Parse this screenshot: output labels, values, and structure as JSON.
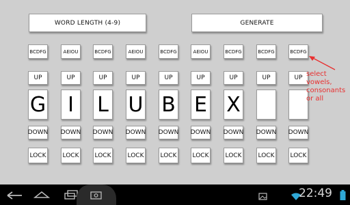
{
  "header": {
    "word_length_label": "WORD LENGTH (4-9)",
    "generate_label": "GENERATE"
  },
  "columns": [
    {
      "type_label": "BCDFG",
      "up_label": "UP",
      "letter": "G",
      "down_label": "DOWN",
      "lock_label": "LOCK"
    },
    {
      "type_label": "AEIOU",
      "up_label": "UP",
      "letter": "I",
      "down_label": "DOWN",
      "lock_label": "LOCK"
    },
    {
      "type_label": "BCDFG",
      "up_label": "UP",
      "letter": "L",
      "down_label": "DOWN",
      "lock_label": "LOCK"
    },
    {
      "type_label": "AEIOU",
      "up_label": "UP",
      "letter": "U",
      "down_label": "DOWN",
      "lock_label": "LOCK"
    },
    {
      "type_label": "BCDFG",
      "up_label": "UP",
      "letter": "B",
      "down_label": "DOWN",
      "lock_label": "LOCK"
    },
    {
      "type_label": "AEIOU",
      "up_label": "UP",
      "letter": "E",
      "down_label": "DOWN",
      "lock_label": "LOCK"
    },
    {
      "type_label": "BCDFG",
      "up_label": "UP",
      "letter": "X",
      "down_label": "DOWN",
      "lock_label": "LOCK"
    },
    {
      "type_label": "BCDFG",
      "up_label": "UP",
      "letter": "",
      "down_label": "DOWN",
      "lock_label": "LOCK"
    },
    {
      "type_label": "BCDFG",
      "up_label": "UP",
      "letter": "",
      "down_label": "DOWN",
      "lock_label": "LOCK"
    }
  ],
  "annotation": {
    "text": "select vowels, consonants or all"
  },
  "status_bar": {
    "time": "22:49"
  },
  "colors": {
    "background": "#cfcfcf",
    "annotation": "#e83030",
    "nav_bar": "#000000",
    "wifi": "#2fa8d6"
  },
  "nav_icons": [
    "back-icon",
    "home-icon",
    "recent-apps-icon",
    "screenshot-icon",
    "gallery-icon",
    "wifi-icon",
    "battery-icon"
  ]
}
